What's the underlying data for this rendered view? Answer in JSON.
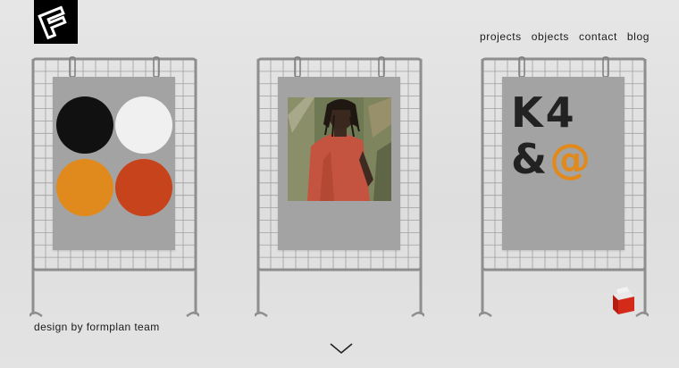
{
  "header": {
    "logo_icon": "formplan-logo-icon",
    "nav": [
      {
        "label": "projects"
      },
      {
        "label": "objects"
      },
      {
        "label": "contact"
      },
      {
        "label": "blog"
      }
    ]
  },
  "stands": [
    {
      "poster": "color-circles",
      "circles": [
        "#111111",
        "#f0f0f0",
        "#e08a1e",
        "#c7431c"
      ]
    },
    {
      "poster": "portrait-photo"
    },
    {
      "poster": "typography",
      "text_line1": "K4",
      "text_amp": "&",
      "text_at": "@",
      "accent": "#e08a1e"
    }
  ],
  "footer": {
    "credit": "design by formplan team",
    "scroll_icon": "chevron-down-icon"
  },
  "colors": {
    "background": "#e2e2e2",
    "poster_gray": "#a3a3a3",
    "frame_metal": "#8e8e8e",
    "accent_orange": "#e08a1e",
    "accent_red": "#c7431c"
  }
}
